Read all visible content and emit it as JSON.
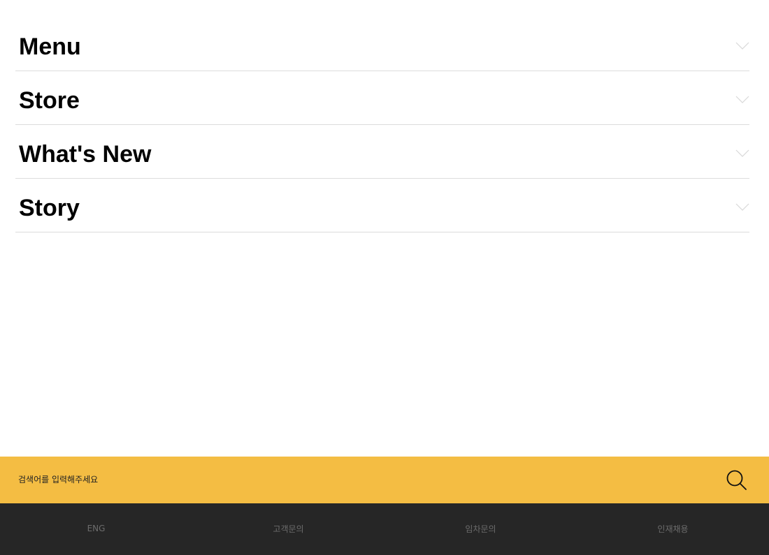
{
  "accordion": {
    "items": [
      {
        "label": "Menu"
      },
      {
        "label": "Store"
      },
      {
        "label": "What's New"
      },
      {
        "label": "Story"
      }
    ]
  },
  "search": {
    "placeholder": "검색어를 입력해주세요",
    "icon": "search-icon"
  },
  "footer": {
    "links": [
      {
        "label": "ENG"
      },
      {
        "label": "고객문의"
      },
      {
        "label": "임차문의"
      },
      {
        "label": "인재채용"
      }
    ]
  },
  "colors": {
    "search_bar_bg": "#f4bd43",
    "footer_bg": "#262626",
    "footer_text": "#6c6c6c",
    "divider": "#dcdcdc",
    "chevron": "#d8d8d8"
  }
}
